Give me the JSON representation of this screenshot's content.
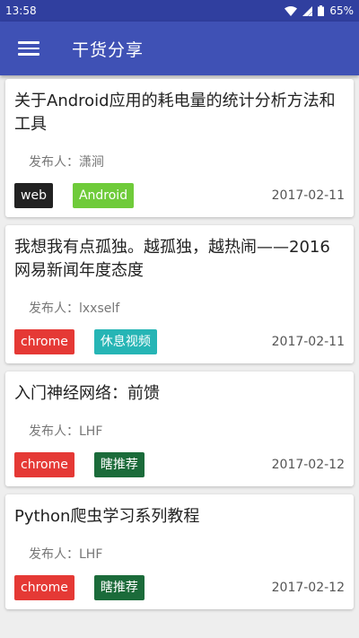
{
  "status_bar": {
    "time": "13:58",
    "battery": "65%"
  },
  "app_bar": {
    "title": "干货分享"
  },
  "cards": [
    {
      "title": "关于Android应用的耗电量的统计分析方法和工具",
      "author": "发布人：潇涧",
      "tags": [
        {
          "label": "web",
          "color": "#222222"
        },
        {
          "label": "Android",
          "color": "#6fcb3a"
        }
      ],
      "date": "2017-02-11"
    },
    {
      "title": "我想我有点孤独。越孤独，越热闹——2016网易新闻年度态度",
      "author": "发布人：lxxself",
      "tags": [
        {
          "label": "chrome",
          "color": "#e53935"
        },
        {
          "label": "休息视频",
          "color": "#26b5b5"
        }
      ],
      "date": "2017-02-11"
    },
    {
      "title": "入门神经网络：前馈",
      "author": "发布人：LHF",
      "tags": [
        {
          "label": "chrome",
          "color": "#e53935"
        },
        {
          "label": "瞎推荐",
          "color": "#1b6b3a"
        }
      ],
      "date": "2017-02-12"
    },
    {
      "title": "Python爬虫学习系列教程",
      "author": "发布人：LHF",
      "tags": [
        {
          "label": "chrome",
          "color": "#e53935"
        },
        {
          "label": "瞎推荐",
          "color": "#1b6b3a"
        }
      ],
      "date": "2017-02-12"
    }
  ]
}
